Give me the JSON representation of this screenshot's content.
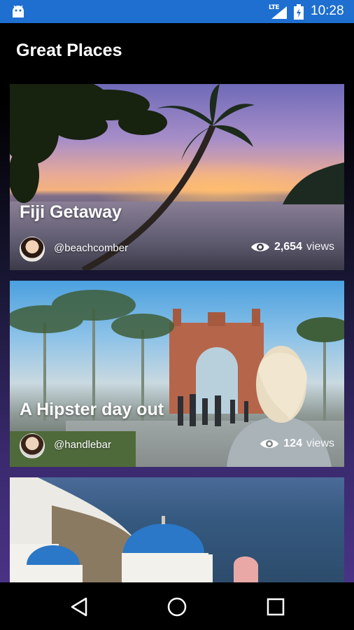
{
  "status_bar": {
    "network": "LTE",
    "time": "10:28",
    "background_color": "#1e6fd0",
    "icons": [
      "android-icon",
      "signal-icon",
      "battery-icon"
    ]
  },
  "app": {
    "title": "Great Places"
  },
  "cards": [
    {
      "title": "Fiji Getaway",
      "handle": "@beachcomber",
      "views": "2,654",
      "views_label": "views"
    },
    {
      "title": "A Hipster day out",
      "handle": "@handlebar",
      "views": "124",
      "views_label": "views"
    },
    {
      "title": "",
      "handle": "",
      "views": "",
      "views_label": ""
    }
  ],
  "nav_bar": {
    "buttons": [
      "back-icon",
      "home-icon",
      "recents-icon"
    ]
  }
}
